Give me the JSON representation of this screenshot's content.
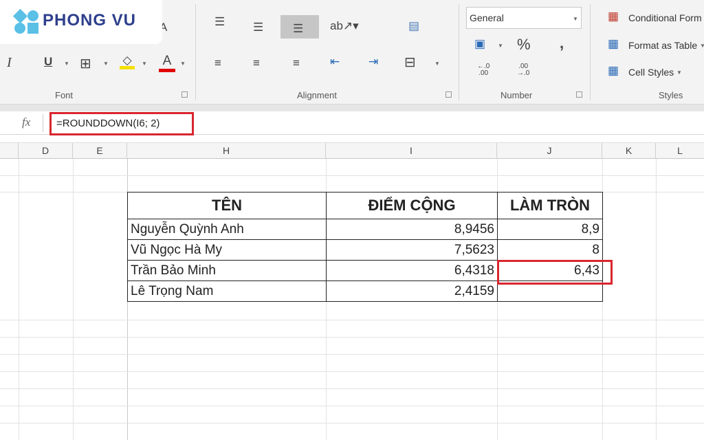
{
  "brand": {
    "logo_text": "PHONG VU"
  },
  "ribbon": {
    "groups": {
      "font": "Font",
      "alignment": "Alignment",
      "number": "Number",
      "styles": "Styles"
    },
    "number_format": "General",
    "percent": "%",
    "comma": ",",
    "increase_decimal": "←.0\n.00",
    "decrease_decimal": ".00\n→.0",
    "conditional_formatting": "Conditional Form",
    "format_as_table": "Format as Table",
    "cell_styles": "Cell Styles",
    "italic": "I",
    "underline": "U",
    "font_color": "A",
    "font_size_up": "A"
  },
  "formula_bar": {
    "fx": "fx",
    "formula": "=ROUNDDOWN(I6; 2)"
  },
  "columns": [
    "D",
    "E",
    "H",
    "I",
    "J",
    "K",
    "L"
  ],
  "table": {
    "headers": [
      "TÊN",
      "ĐIỂM CỘNG",
      "LÀM TRÒN"
    ],
    "rows": [
      [
        "Nguyễn Quỳnh Anh",
        "8,9456",
        "8,9"
      ],
      [
        "Vũ Ngọc Hà My",
        "7,5623",
        "8"
      ],
      [
        "Trần Bảo Minh",
        "6,4318",
        "6,43"
      ],
      [
        "Lê Trọng Nam",
        "2,4159",
        ""
      ]
    ]
  },
  "colors": {
    "highlight": "#d8262e",
    "brand": "#2e3f8c"
  }
}
